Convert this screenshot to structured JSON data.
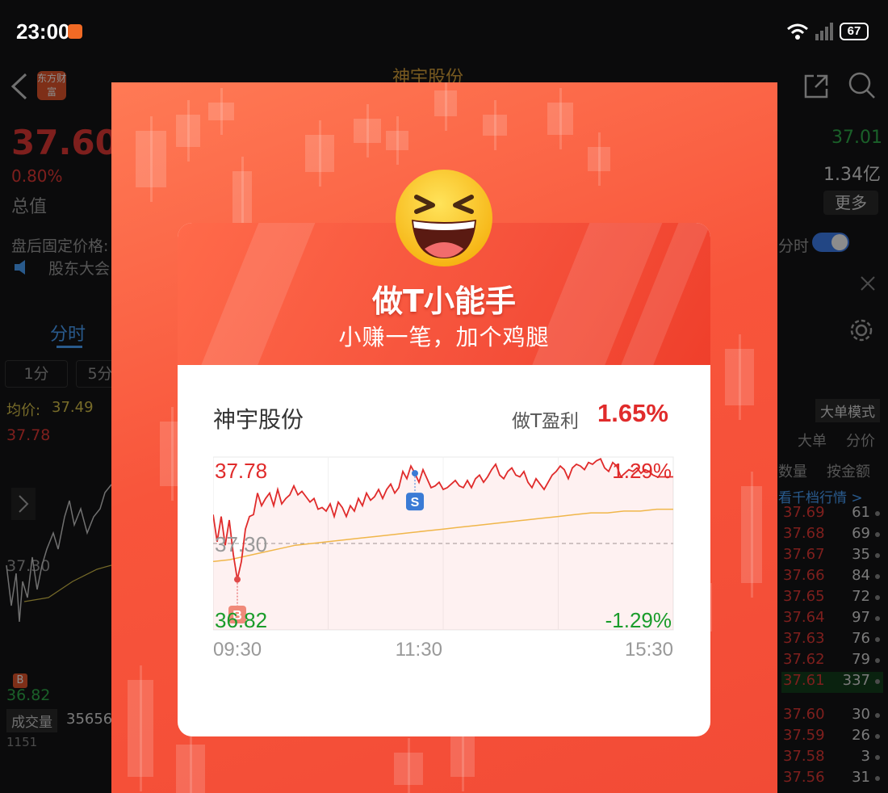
{
  "status_bar": {
    "time": "23:00",
    "battery": "67"
  },
  "background": {
    "stock_name": "神宇股份",
    "broker_logo": "东方财富",
    "price": "37.60",
    "change_pct": "0.80%",
    "total_value_label": "总值",
    "right_price": "37.01",
    "right_amount": "1.34亿",
    "more_label": "更多",
    "after_hours_label": "盘后固定价格:",
    "fenshi_toggle": "分时",
    "notice_text": "股东大会",
    "tab_fenshi": "分时",
    "period_1": "1分",
    "period_5": "5分",
    "avg_label": "均价:",
    "avg_value": "37.49",
    "hi_price": "37.78",
    "mid_price": "37.30",
    "lo_price": "36.82",
    "vol_label": "成交量",
    "vol_value": "35656",
    "vol_axis": "1151",
    "big_order_mode": "大单模式",
    "tab_big": "大单",
    "tab_split": "分价",
    "tab_count": "数量",
    "tab_amount": "按金额",
    "view_depth": "看千档行情 >",
    "order_book": [
      {
        "price": "37.69",
        "vol": "61"
      },
      {
        "price": "37.68",
        "vol": "69"
      },
      {
        "price": "37.67",
        "vol": "35"
      },
      {
        "price": "37.66",
        "vol": "84"
      },
      {
        "price": "37.65",
        "vol": "72"
      },
      {
        "price": "37.64",
        "vol": "97"
      },
      {
        "price": "37.63",
        "vol": "76"
      },
      {
        "price": "37.62",
        "vol": "79"
      },
      {
        "price": "37.61",
        "vol": "337"
      },
      {
        "price": "37.60",
        "vol": "30"
      },
      {
        "price": "37.59",
        "vol": "26"
      },
      {
        "price": "37.58",
        "vol": "3"
      },
      {
        "price": "37.56",
        "vol": "31"
      }
    ]
  },
  "popup": {
    "title": "做T小能手",
    "subtitle": "小赚一笔，加个鸡腿",
    "stock_name": "神宇股份",
    "profit_label": "做T盈利",
    "profit_value": "1.65%",
    "sell_marker": "S",
    "buy_marker": "B",
    "colors": {
      "accent": "#f5513b",
      "up": "#e02b2b",
      "down": "#1a9c2a",
      "avg_line": "#f0b64a"
    }
  },
  "chart_data": {
    "type": "line",
    "x_labels": [
      "09:30",
      "11:30",
      "15:30"
    ],
    "y_top": "37.78",
    "y_mid": "37.30",
    "y_bottom": "36.82",
    "right_top_pct": "1.29%",
    "right_bottom_pct": "-1.29%",
    "ylim": [
      36.82,
      37.78
    ],
    "reference_price": 37.3,
    "price_series": [
      37.46,
      37.31,
      37.45,
      37.29,
      37.43,
      37.24,
      37.1,
      37.2,
      37.38,
      37.45,
      37.46,
      37.58,
      37.51,
      37.55,
      37.58,
      37.51,
      37.6,
      37.52,
      37.55,
      37.57,
      37.62,
      37.57,
      37.59,
      37.56,
      37.53,
      37.55,
      37.49,
      37.5,
      37.48,
      37.52,
      37.45,
      37.53,
      37.5,
      37.45,
      37.51,
      37.48,
      37.55,
      37.51,
      37.58,
      37.54,
      37.56,
      37.6,
      37.55,
      37.6,
      37.63,
      37.58,
      37.61,
      37.7,
      37.66,
      37.73,
      37.69,
      37.64,
      37.71,
      37.66,
      37.61,
      37.62,
      37.64,
      37.6,
      37.61,
      37.63,
      37.65,
      37.62,
      37.61,
      37.65,
      37.61,
      37.66,
      37.68,
      37.64,
      37.67,
      37.71,
      37.74,
      37.68,
      37.66,
      37.7,
      37.72,
      37.68,
      37.67,
      37.7,
      37.64,
      37.61,
      37.66,
      37.63,
      37.6,
      37.64,
      37.68,
      37.7,
      37.73,
      37.71,
      37.66,
      37.72,
      37.74,
      37.73,
      37.71,
      37.75,
      37.74,
      37.76,
      37.77,
      37.72,
      37.7,
      37.75,
      37.73,
      37.67,
      37.69,
      37.71,
      37.7,
      37.72,
      37.69,
      37.71,
      37.7,
      37.68,
      37.67,
      37.67,
      37.67,
      37.67,
      37.67
    ],
    "avg_series": [
      37.2,
      37.21,
      37.23,
      37.25,
      37.27,
      37.29,
      37.3,
      37.31,
      37.32,
      37.33,
      37.34,
      37.35,
      37.36,
      37.37,
      37.38,
      37.39,
      37.4,
      37.41,
      37.42,
      37.43,
      37.44,
      37.45,
      37.46,
      37.47,
      37.47,
      37.48,
      37.48,
      37.49,
      37.49
    ],
    "sell_point_index": 50,
    "buy_point_index": 6
  }
}
